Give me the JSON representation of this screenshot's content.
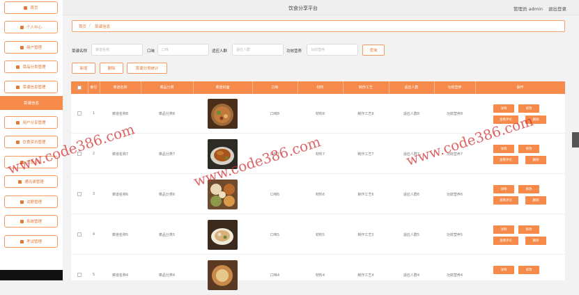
{
  "header": {
    "title": "饮食分享平台",
    "user": "管理员 admin",
    "logout": "退出登录"
  },
  "sidebar": {
    "items": [
      {
        "label": "首页"
      },
      {
        "label": "个人中心"
      },
      {
        "label": "用户管理"
      },
      {
        "label": "菜品分类管理"
      },
      {
        "label": "菜谱信息管理"
      },
      {
        "label": "菜谱信息"
      },
      {
        "label": "用户分享管理"
      },
      {
        "label": "饮食资讯管理"
      },
      {
        "label": "饮食论坛"
      },
      {
        "label": "通讯录管理"
      },
      {
        "label": "试题管理"
      },
      {
        "label": "系统管理"
      },
      {
        "label": "考试管理"
      }
    ]
  },
  "breadcrumb": {
    "home": "首页",
    "sep": "/",
    "current": "菜谱信息"
  },
  "search": {
    "fields": [
      {
        "label": "菜谱名称",
        "placeholder": "菜谱名称"
      },
      {
        "label": "口味",
        "placeholder": "口味"
      },
      {
        "label": "适应人群",
        "placeholder": "适应人群"
      },
      {
        "label": "功效营养",
        "placeholder": "功效营养"
      }
    ],
    "button": "查询"
  },
  "toolbar": {
    "add": "新增",
    "delete": "删除",
    "stats": "菜谱分类统计"
  },
  "table": {
    "columns": [
      "索引",
      "菜谱名称",
      "菜品分类",
      "菜谱封面",
      "口味",
      "材料",
      "制作工艺",
      "适应人群",
      "功效营养",
      "操作"
    ],
    "actions": {
      "detail": "详情",
      "edit": "修改",
      "review": "查看评论",
      "remove": "删除"
    },
    "rows": [
      {
        "index": "1",
        "name": "菜谱名称8",
        "category": "菜品分类8",
        "taste": "口味8",
        "material": "材料8",
        "craft": "制作工艺8",
        "crowd": "适应人群8",
        "nutrition": "功效营养8"
      },
      {
        "index": "2",
        "name": "菜谱名称7",
        "category": "菜品分类7",
        "taste": "口味7",
        "material": "材料7",
        "craft": "制作工艺7",
        "crowd": "适应人群7",
        "nutrition": "功效营养7"
      },
      {
        "index": "3",
        "name": "菜谱名称6",
        "category": "菜品分类6",
        "taste": "口味6",
        "material": "材料6",
        "craft": "制作工艺6",
        "crowd": "适应人群6",
        "nutrition": "功效营养6"
      },
      {
        "index": "4",
        "name": "菜谱名称5",
        "category": "菜品分类5",
        "taste": "口味5",
        "material": "材料5",
        "craft": "制作工艺5",
        "crowd": "适应人群5",
        "nutrition": "功效营养5"
      },
      {
        "index": "5",
        "name": "菜谱名称4",
        "category": "菜品分类4",
        "taste": "口味4",
        "material": "材料4",
        "craft": "制作工艺4",
        "crowd": "适应人群4",
        "nutrition": "功效营养4"
      }
    ]
  },
  "watermark": {
    "text": "www.code386.com"
  },
  "colors": {
    "accent": "#f58a4a",
    "accent_light": "#f59a5e",
    "watermark": "#d23232"
  }
}
